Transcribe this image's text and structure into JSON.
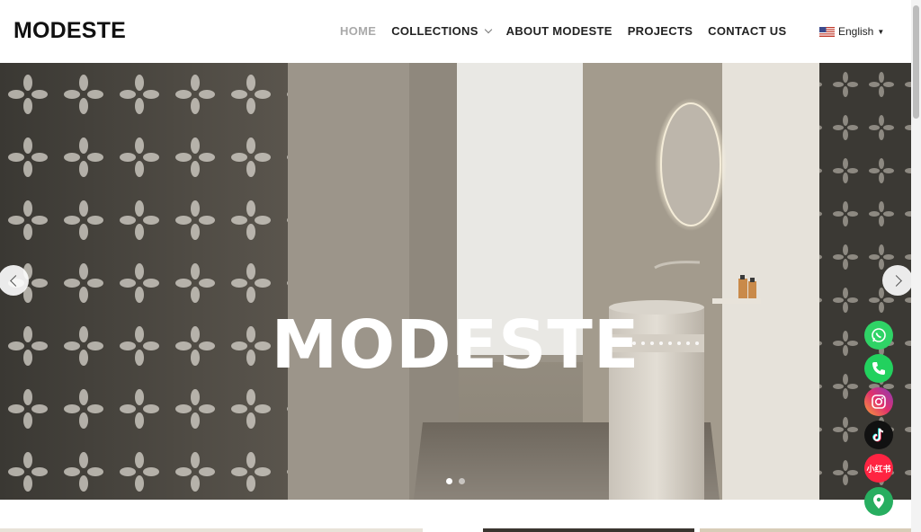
{
  "brand": {
    "logo": "MODESTE"
  },
  "nav": {
    "items": [
      {
        "label": "HOME",
        "active": true
      },
      {
        "label": "COLLECTIONS",
        "has_dropdown": true
      },
      {
        "label": "ABOUT MODESTE"
      },
      {
        "label": "PROJECTS"
      },
      {
        "label": "CONTACT US"
      }
    ]
  },
  "language": {
    "label": "English",
    "icon": "us-flag-icon"
  },
  "hero": {
    "title": "MODESTE",
    "slides_total": 2,
    "active_slide": 1
  },
  "social": [
    {
      "name": "whatsapp",
      "color": "#2fd366"
    },
    {
      "name": "phone",
      "color": "#22d15e"
    },
    {
      "name": "instagram",
      "color": "#d6317c"
    },
    {
      "name": "tiktok",
      "color": "#111111"
    },
    {
      "name": "xiaohongshu",
      "label": "小红书",
      "color": "#ff2442"
    },
    {
      "name": "location",
      "color": "#27ae60"
    }
  ],
  "colors": {
    "active_nav": "#a9a9a9",
    "text": "#222222"
  }
}
